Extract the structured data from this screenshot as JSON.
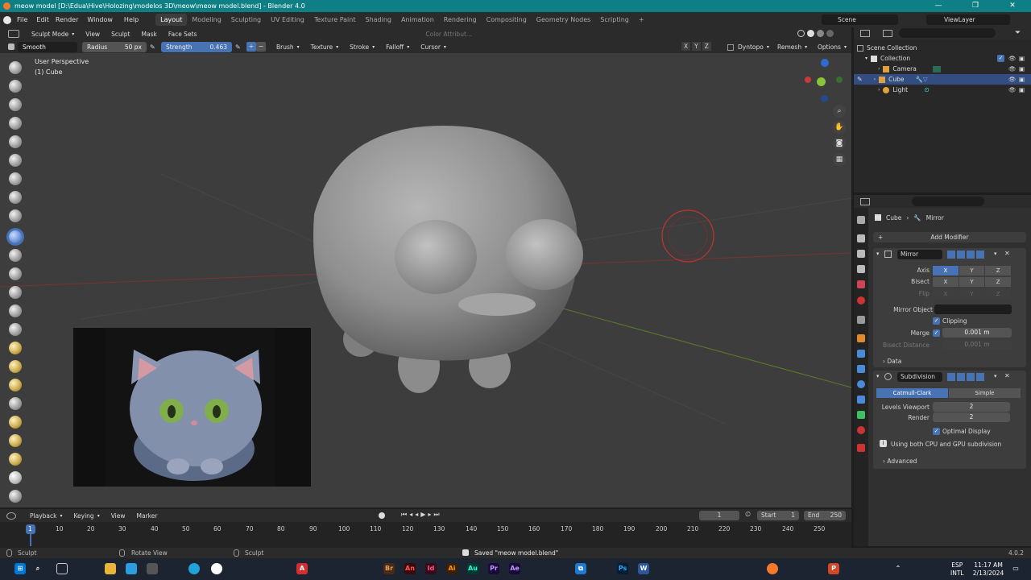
{
  "window": {
    "title": "meow model [D:\\Edua\\Hive\\Holozing\\modelos 3D\\meow\\meow model.blend] - Blender 4.0",
    "min": "—",
    "max": "❐",
    "close": "✕"
  },
  "menu": {
    "items": [
      "File",
      "Edit",
      "Render",
      "Window",
      "Help"
    ]
  },
  "workspaces": [
    "Layout",
    "Modeling",
    "Sculpting",
    "UV Editing",
    "Texture Paint",
    "Shading",
    "Animation",
    "Rendering",
    "Compositing",
    "Geometry Nodes",
    "Scripting"
  ],
  "workspace_add": "+",
  "scene": {
    "label": "Scene",
    "viewlayer": "ViewLayer"
  },
  "header": {
    "mode": "Sculpt Mode",
    "menus": [
      "View",
      "Sculpt",
      "Mask",
      "Face Sets"
    ],
    "color_attr": "Color Attribut..."
  },
  "toolsettings": {
    "brush": "Smooth",
    "radius_label": "Radius",
    "radius_value": "50 px",
    "strength_label": "Strength",
    "strength_value": "0.463",
    "menus": [
      "Brush",
      "Texture",
      "Stroke",
      "Falloff",
      "Cursor"
    ],
    "axes": [
      "X",
      "Y",
      "Z"
    ],
    "dyntopo": "Dyntopo",
    "remesh": "Remesh",
    "options": "Options"
  },
  "viewport": {
    "perspective": "User Perspective",
    "object": "(1) Cube"
  },
  "outliner": {
    "root": "Scene Collection",
    "collection": "Collection",
    "items": [
      "Camera",
      "Cube",
      "Light"
    ]
  },
  "properties": {
    "breadcrumb_object": "Cube",
    "breadcrumb_modifier": "Mirror",
    "add_modifier": "Add Modifier",
    "mirror": {
      "name": "Mirror",
      "axis_label": "Axis",
      "bisect_label": "Bisect",
      "flip_label": "Flip",
      "x": "X",
      "y": "Y",
      "z": "Z",
      "mirror_object_label": "Mirror Object",
      "clipping": "Clipping",
      "merge_label": "Merge",
      "merge_value": "0.001 m",
      "bisect_distance_label": "Bisect Distance",
      "bisect_distance_value": "0.001 m",
      "data": "Data"
    },
    "subdivision": {
      "name": "Subdivision",
      "catmull": "Catmull-Clark",
      "simple": "Simple",
      "levels_label": "Levels Viewport",
      "levels_value": "2",
      "render_label": "Render",
      "render_value": "2",
      "optimal": "Optimal Display",
      "info": "Using both CPU and GPU subdivision",
      "advanced": "Advanced"
    }
  },
  "timeline": {
    "menus": [
      "Playback",
      "Keying",
      "View",
      "Marker"
    ],
    "current_frame": "1",
    "start_label": "Start",
    "start": "1",
    "end_label": "End",
    "end": "250",
    "ticks": [
      "1",
      "10",
      "20",
      "30",
      "40",
      "50",
      "60",
      "70",
      "80",
      "90",
      "100",
      "110",
      "120",
      "130",
      "140",
      "150",
      "160",
      "170",
      "180",
      "190",
      "200",
      "210",
      "220",
      "230",
      "240",
      "250"
    ]
  },
  "status": {
    "left": "Sculpt",
    "mid": "Rotate View",
    "right": "Sculpt",
    "saved": "Saved \"meow model.blend\"",
    "version": "4.0.2"
  },
  "taskbar": {
    "lang": "ESP",
    "layout": "INTL",
    "time": "11:17 AM",
    "date": "2/13/2024"
  }
}
